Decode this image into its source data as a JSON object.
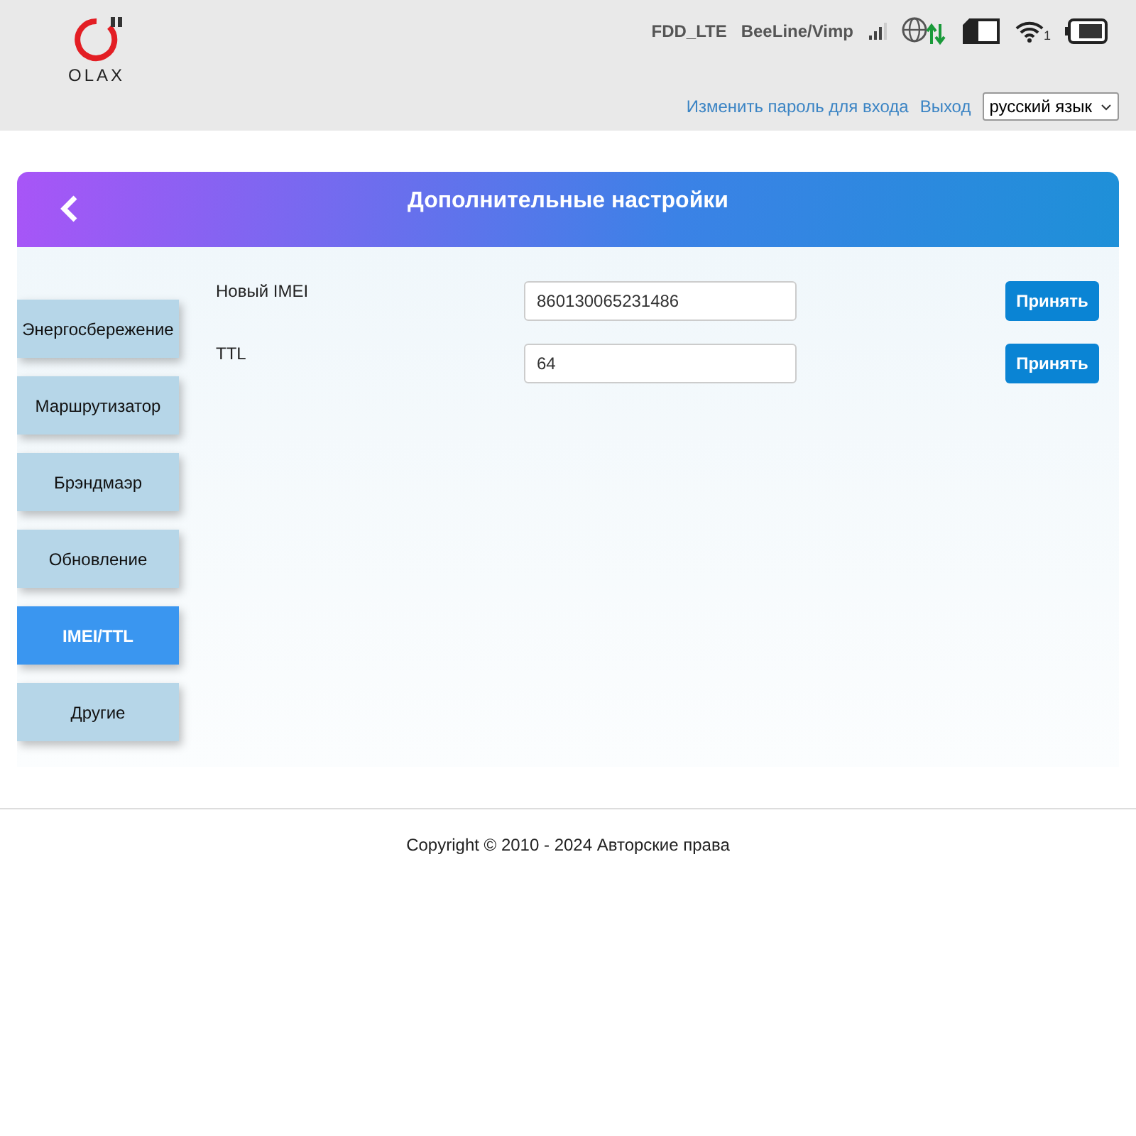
{
  "header": {
    "logo_text": "OLAX",
    "network_type": "FDD_LTE",
    "operator": "BeeLine/Vimp",
    "wifi_clients": "1",
    "links": [
      "Изменить пароль для входа",
      "Выход"
    ],
    "language": "русский язык"
  },
  "panel": {
    "title": "Дополнительные настройки",
    "menu": [
      {
        "label": "Энергосбережение",
        "selected": false
      },
      {
        "label": "Маршрутизатор",
        "selected": false
      },
      {
        "label": "Брэндмаэр",
        "selected": false
      },
      {
        "label": "Обновление",
        "selected": false
      },
      {
        "label": "IMEI/TTL",
        "selected": true
      },
      {
        "label": "Другие",
        "selected": false
      }
    ],
    "fields": [
      {
        "label": "Новый IMEI",
        "value": "860130065231486",
        "button": "Принять"
      },
      {
        "label": "TTL",
        "value": "64",
        "button": "Принять"
      }
    ]
  },
  "footer": "Copyright © 2010 - 2024 Авторские права"
}
